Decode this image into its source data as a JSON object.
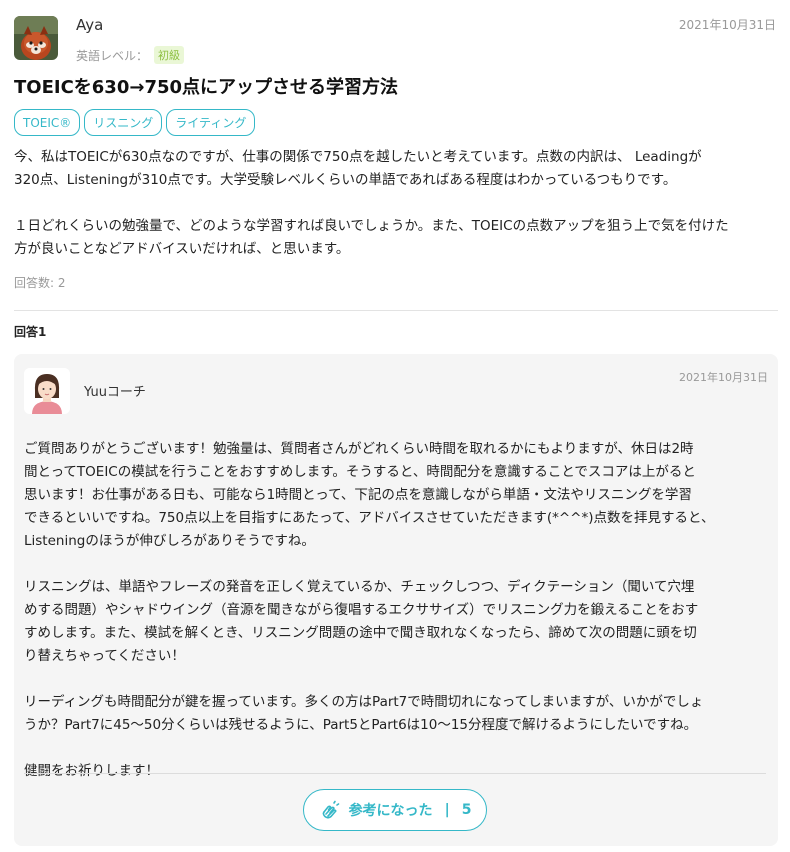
{
  "question": {
    "author": "Aya",
    "level_label": "英語レベル：",
    "level": "初級",
    "date": "2021年10月31日",
    "title": "TOEICを630→750点にアップさせる学習方法",
    "tags": [
      "TOEIC®",
      "リスニング",
      "ライティング"
    ],
    "body": [
      "今、私はTOEICが630点なのですが、仕事の関係で750点を越したいと考えています。点数の内訳は、 Leadingが",
      "320点、Listeningが310点です。大学受験レベルくらいの単語であればある程度はわかっているつもりです。",
      "",
      "１日どれくらいの勉強量で、どのような学習すれば良いでしょうか。また、TOEICの点数アップを狙う上で気を付けた",
      "方が良いことなどアドバイスいだければ、と思います。"
    ],
    "answer_count": "回答数: 2"
  },
  "answer": {
    "label": "回答1",
    "coach_name": "Yuuコーチ",
    "date": "2021年10月31日",
    "body": [
      "ご質問ありがとうございます！勉強量は、質問者さんがどれくらい時間を取れるかにもよりますが、休日は2時",
      "間とってTOEICの模試を行うことをおすすめします。そうすると、時間配分を意識することでスコアは上がると",
      "思います！お仕事がある日も、可能なら1時間とって、下記の点を意識しながら単語・文法やリスニングを学習",
      "できるといいですね。750点以上を目指すにあたって、アドバイスさせていただきます(*^^*)点数を拝見すると、",
      "Listeningのほうが伸びしろがありそうですね。",
      "",
      "リスニングは、単語やフレーズの発音を正しく覚えているか、チェックしつつ、ディクテーション（聞いて穴埋",
      "めする問題）やシャドウイング（音源を聞きながら復唱するエクササイズ）でリスニング力を鍛えることをおす",
      "すめします。また、模試を解くとき、リスニング問題の途中で聞き取れなくなったら、諦めて次の問題に頭を切",
      "り替えちゃってください！",
      "",
      "リーディングも時間配分が鍵を握っています。多くの方はPart7で時間切れになってしまいますが、いかがでしょ",
      "うか？Part7に45〜50分くらいは残せるように、Part5とPart6は10〜15分程度で解けるようにしたいですね。",
      "",
      "健闘をお祈りします！"
    ],
    "helpful_label": "参考になった",
    "helpful_sep": "|",
    "helpful_count": "5"
  },
  "colors": {
    "accent": "#35b8c8",
    "level_badge_bg": "#eaf7d6",
    "level_badge_text": "#8cbf3f",
    "card_bg": "#f5f5f5"
  },
  "icons": {
    "question_avatar": "red-panda-avatar",
    "coach_avatar": "woman-avatar",
    "helpful_icon": "clap-hands-icon"
  }
}
